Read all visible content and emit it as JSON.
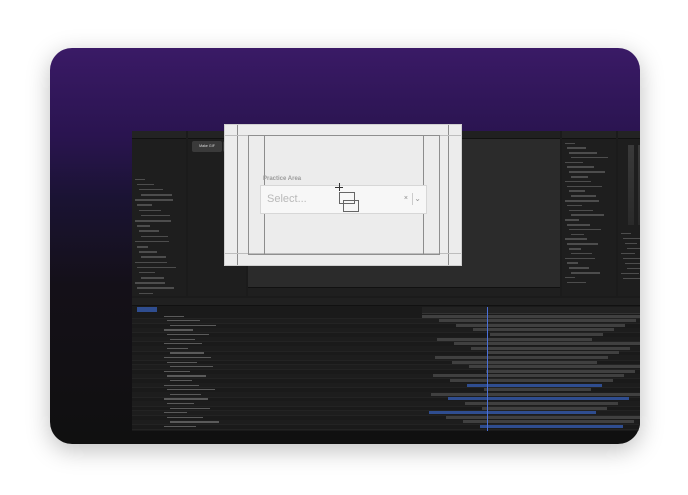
{
  "composition": {
    "area_label": "Practice Area",
    "select_placeholder": "Select...",
    "clear_icon": "×",
    "dropdown_icon": "chevron-down-icon"
  },
  "toolbar": {
    "make_gif_label": "Make GIF"
  },
  "colors": {
    "card_top": "#3a1a66",
    "card_bottom": "#101010",
    "app_bg": "#1b1b1b",
    "comp_bg": "#ececec",
    "timeline_accent": "#4a6fd8"
  }
}
